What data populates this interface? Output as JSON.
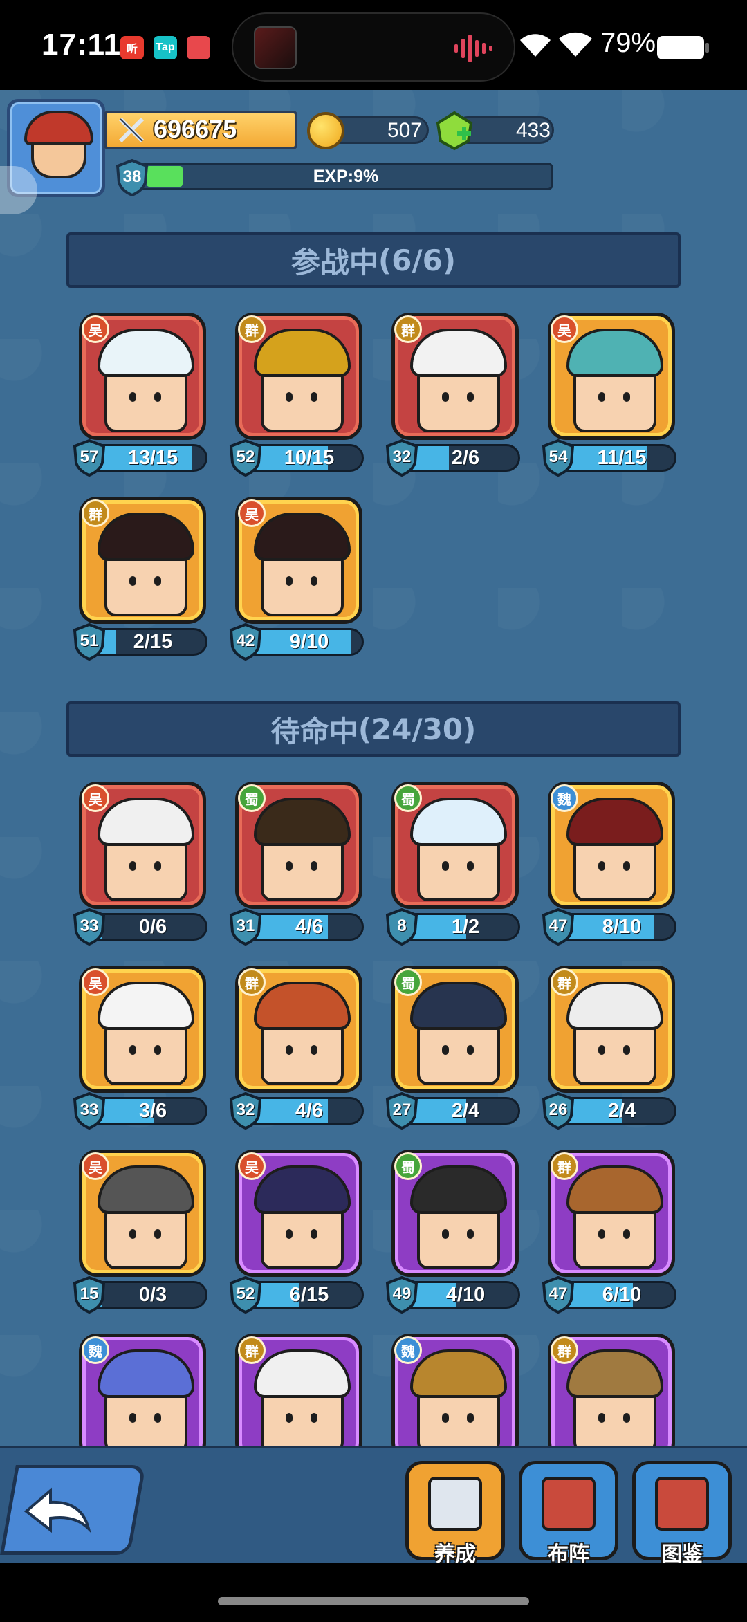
{
  "status_bar": {
    "time": "17:11",
    "notif_icons": [
      {
        "label": "听",
        "color": "#e83a2e"
      },
      {
        "label": "Tap",
        "color": "#17c2c7"
      },
      {
        "label": "",
        "color": "#e8484c"
      }
    ],
    "battery": "79%"
  },
  "player": {
    "power": "696675",
    "coins": "507",
    "gems": "433",
    "level": "38",
    "exp_text": "EXP:9%",
    "exp_percent": 9
  },
  "sections": [
    {
      "title": "参战中",
      "count": "(6/6)",
      "heroes": [
        {
          "faction": "吴",
          "fac_class": "fac-wu",
          "rarity": "red",
          "level": "57",
          "progress": "13/15",
          "fill": 0.87,
          "hair": "#e9f4f9"
        },
        {
          "faction": "群",
          "fac_class": "fac-qun",
          "rarity": "red",
          "level": "52",
          "progress": "10/15",
          "fill": 0.67,
          "hair": "#d5a21c"
        },
        {
          "faction": "群",
          "fac_class": "fac-qun",
          "rarity": "red",
          "level": "32",
          "progress": "2/6",
          "fill": 0.33,
          "hair": "#f2f2f2"
        },
        {
          "faction": "吴",
          "fac_class": "fac-wu",
          "rarity": "gold",
          "level": "54",
          "progress": "11/15",
          "fill": 0.73,
          "hair": "#4fb2b3"
        },
        {
          "faction": "群",
          "fac_class": "fac-qun",
          "rarity": "gold",
          "level": "51",
          "progress": "2/15",
          "fill": 0.13,
          "hair": "#2a1a1a"
        },
        {
          "faction": "吴",
          "fac_class": "fac-wu",
          "rarity": "gold",
          "level": "42",
          "progress": "9/10",
          "fill": 0.9,
          "hair": "#2a1a1a"
        }
      ]
    },
    {
      "title": "待命中",
      "count": "(24/30)",
      "heroes": [
        {
          "faction": "吴",
          "fac_class": "fac-wu",
          "rarity": "red",
          "level": "33",
          "progress": "0/6",
          "fill": 0,
          "hair": "#f0f0f0"
        },
        {
          "faction": "蜀",
          "fac_class": "fac-shu",
          "rarity": "red",
          "level": "31",
          "progress": "4/6",
          "fill": 0.67,
          "hair": "#3a2a1a"
        },
        {
          "faction": "蜀",
          "fac_class": "fac-shu",
          "rarity": "red",
          "level": "8",
          "progress": "1/2",
          "fill": 0.5,
          "hair": "#dff0fb"
        },
        {
          "faction": "魏",
          "fac_class": "fac-wei",
          "rarity": "gold",
          "level": "47",
          "progress": "8/10",
          "fill": 0.8,
          "hair": "#7a1d1d"
        },
        {
          "faction": "吴",
          "fac_class": "fac-wu",
          "rarity": "gold",
          "level": "33",
          "progress": "3/6",
          "fill": 0.5,
          "hair": "#f4f4f4"
        },
        {
          "faction": "群",
          "fac_class": "fac-qun",
          "rarity": "gold",
          "level": "32",
          "progress": "4/6",
          "fill": 0.67,
          "hair": "#c4522a"
        },
        {
          "faction": "蜀",
          "fac_class": "fac-shu",
          "rarity": "gold",
          "level": "27",
          "progress": "2/4",
          "fill": 0.5,
          "hair": "#27344f"
        },
        {
          "faction": "群",
          "fac_class": "fac-qun",
          "rarity": "gold",
          "level": "26",
          "progress": "2/4",
          "fill": 0.5,
          "hair": "#ededed"
        },
        {
          "faction": "吴",
          "fac_class": "fac-wu",
          "rarity": "gold",
          "level": "15",
          "progress": "0/3",
          "fill": 0,
          "hair": "#555555"
        },
        {
          "faction": "吴",
          "fac_class": "fac-wu",
          "rarity": "purple",
          "level": "52",
          "progress": "6/15",
          "fill": 0.4,
          "hair": "#2c2a5a"
        },
        {
          "faction": "蜀",
          "fac_class": "fac-shu",
          "rarity": "purple",
          "level": "49",
          "progress": "4/10",
          "fill": 0.4,
          "hair": "#2a2a2a"
        },
        {
          "faction": "群",
          "fac_class": "fac-qun",
          "rarity": "purple",
          "level": "47",
          "progress": "6/10",
          "fill": 0.6,
          "hair": "#a8662e"
        },
        {
          "faction": "魏",
          "fac_class": "fac-wei",
          "rarity": "purple",
          "level": "",
          "progress": "",
          "fill": 0,
          "hair": "#5b6fd6"
        },
        {
          "faction": "群",
          "fac_class": "fac-qun",
          "rarity": "purple",
          "level": "",
          "progress": "",
          "fill": 0,
          "hair": "#f0f0f0"
        },
        {
          "faction": "魏",
          "fac_class": "fac-wei",
          "rarity": "purple",
          "level": "",
          "progress": "",
          "fill": 0,
          "hair": "#b8862e"
        },
        {
          "faction": "群",
          "fac_class": "fac-qun",
          "rarity": "purple",
          "level": "",
          "progress": "",
          "fill": 0,
          "hair": "#a07a40"
        }
      ]
    }
  ],
  "bottom_nav": {
    "back_icon": "back-arrow-icon",
    "buttons": [
      {
        "label": "养成",
        "icon": "sword-icon",
        "color": "#f0a232"
      },
      {
        "label": "布阵",
        "icon": "formation-book-icon",
        "color": "#3d8fd6"
      },
      {
        "label": "图鉴",
        "icon": "codex-book-icon",
        "color": "#3d8fd6"
      }
    ]
  }
}
